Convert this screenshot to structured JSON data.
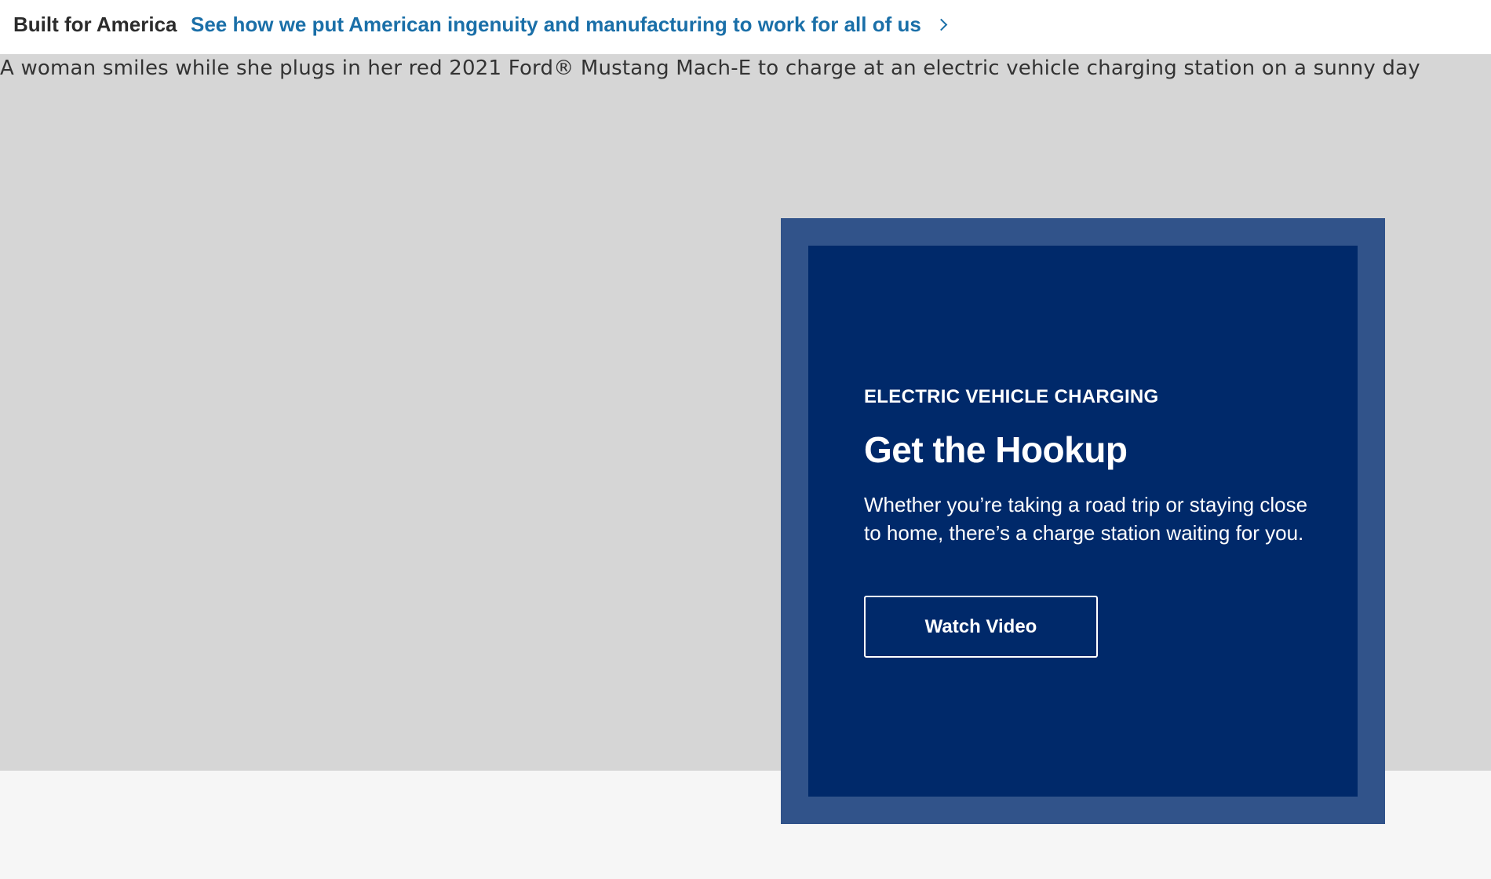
{
  "banner": {
    "title": "Built for America",
    "link_text": "See how we put American ingenuity and manufacturing to work for all of us"
  },
  "hero": {
    "image_alt_text": "A woman smiles while she plugs in her red 2021 Ford® Mustang Mach-E to charge at an electric vehicle charging station on a sunny day"
  },
  "card": {
    "eyebrow": "ELECTRIC VEHICLE CHARGING",
    "headline": "Get the Hookup",
    "body": "Whether you’re taking a road trip or staying close to home, there’s a charge station waiting for you.",
    "button_label": "Watch Video"
  },
  "colors": {
    "link_blue": "#1a6fa8",
    "card_navy": "#00296a",
    "card_frame": "#31538a",
    "hero_placeholder": "#d6d6d6"
  },
  "icons": {
    "banner_link_arrow": "chevron-right-icon"
  }
}
